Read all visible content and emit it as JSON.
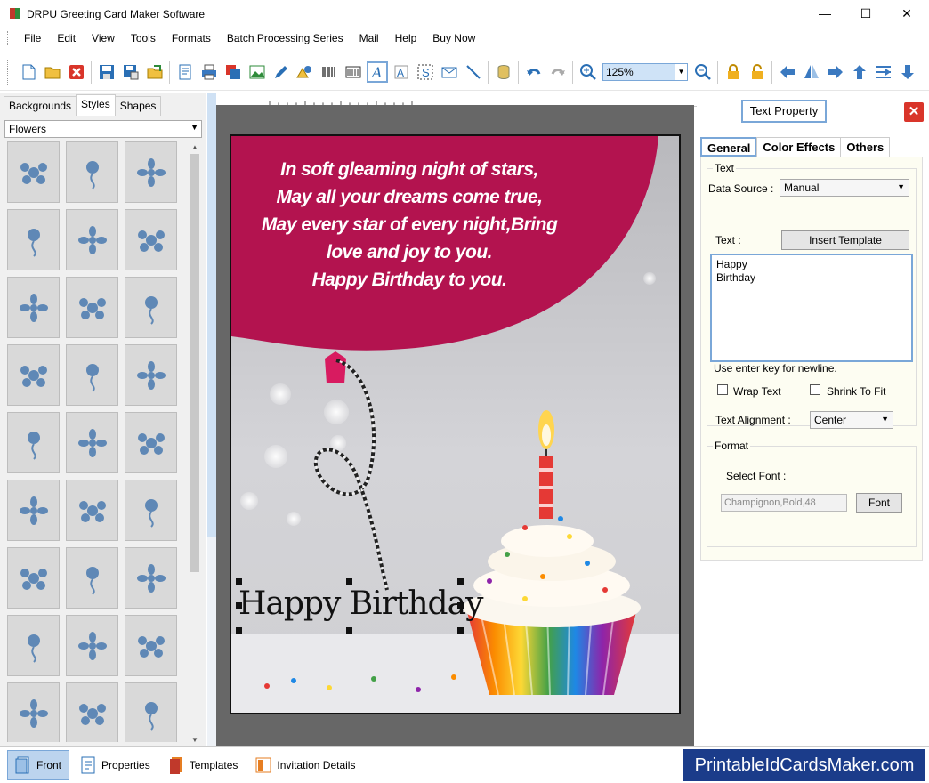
{
  "window": {
    "title": "DRPU Greeting Card Maker Software"
  },
  "menu": [
    "File",
    "Edit",
    "View",
    "Tools",
    "Formats",
    "Batch Processing Series",
    "Mail",
    "Help",
    "Buy Now"
  ],
  "toolbar": {
    "zoom_value": "125%"
  },
  "left_panel": {
    "tabs": [
      "Backgrounds",
      "Styles",
      "Shapes"
    ],
    "active_tab": "Styles",
    "category": "Flowers"
  },
  "card": {
    "verse_lines": [
      "In soft gleaming night of stars,",
      "May all your dreams come true,",
      "May every star of every night,Bring",
      "love and joy to you.",
      "Happy Birthday to you."
    ],
    "selected_text": "Happy Birthday"
  },
  "right_panel": {
    "title": "Text Property",
    "tabs": [
      "General",
      "Color Effects",
      "Others"
    ],
    "text_group": "Text",
    "data_source_label": "Data Source :",
    "data_source_value": "Manual",
    "text_label": "Text :",
    "insert_template": "Insert Template",
    "text_value": "Happy\n Birthday",
    "newline_hint": "Use enter key for newline.",
    "wrap_text": "Wrap Text",
    "shrink_to_fit": "Shrink To Fit",
    "alignment_label": "Text Alignment :",
    "alignment_value": "Center",
    "format_group": "Format",
    "select_font_label": "Select Font :",
    "font_value": "Champignon,Bold,48",
    "font_button": "Font"
  },
  "bottom": {
    "tabs": [
      "Front",
      "Properties",
      "Templates",
      "Invitation Details"
    ],
    "brand": "PrintableIdCardsMaker.com"
  },
  "colors": {
    "accent": "#7aa7d8",
    "card_banner": "#b3134f",
    "brand_bg": "#1b3c8a",
    "close": "#d9352a"
  }
}
